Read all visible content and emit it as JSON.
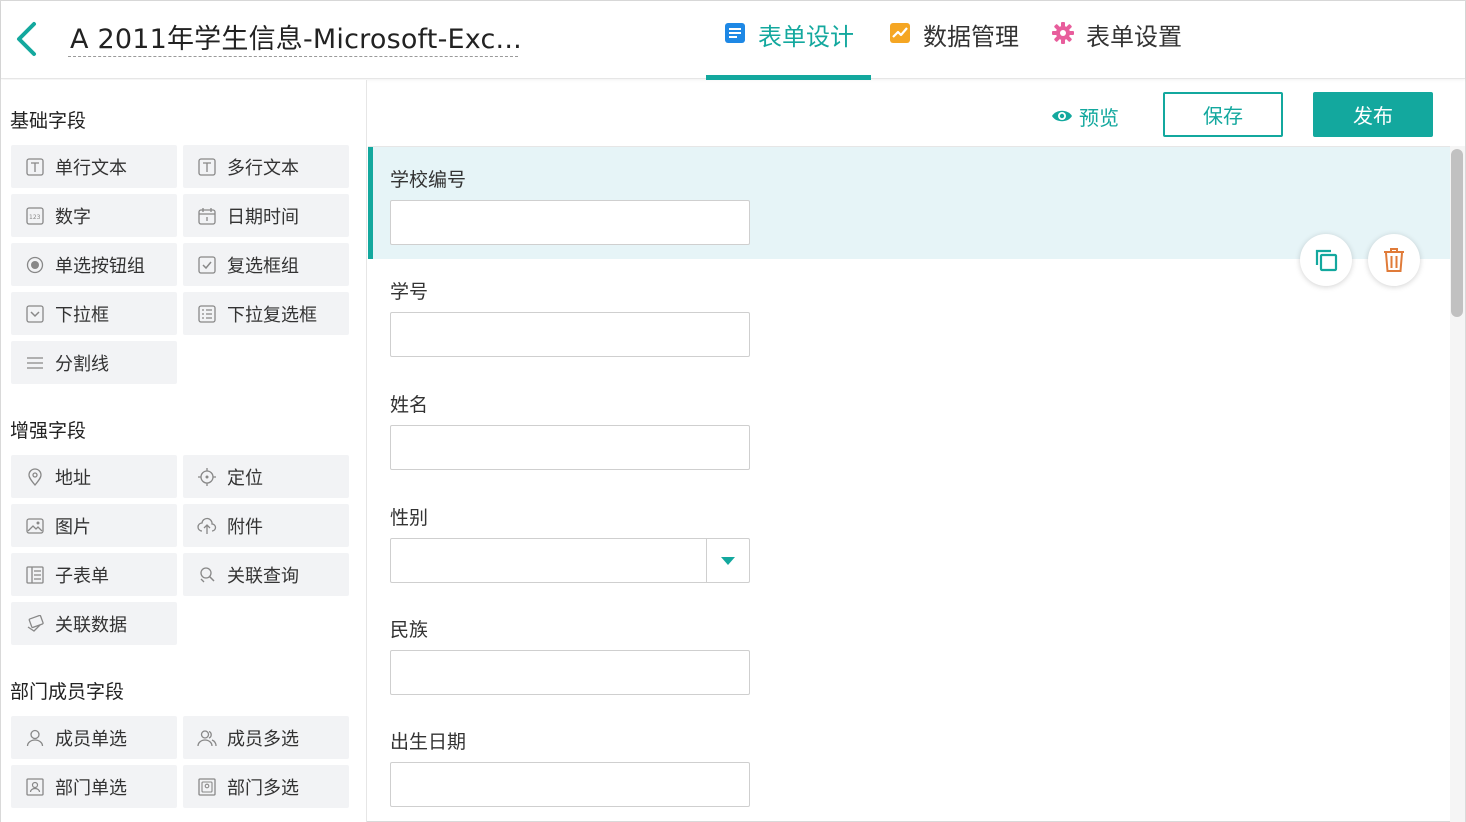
{
  "header": {
    "title": "A 2011年学生信息-Microsoft-Exc...",
    "tabs": [
      {
        "label": "表单设计",
        "icon": "form-doc-icon",
        "active": true
      },
      {
        "label": "数据管理",
        "icon": "chart-icon",
        "active": false
      },
      {
        "label": "表单设置",
        "icon": "gear-icon",
        "active": false
      }
    ]
  },
  "sidebar": {
    "sections": [
      {
        "title": "基础字段",
        "items": [
          {
            "label": "单行文本",
            "icon": "text-icon"
          },
          {
            "label": "多行文本",
            "icon": "textarea-icon"
          },
          {
            "label": "数字",
            "icon": "number-icon"
          },
          {
            "label": "日期时间",
            "icon": "calendar-icon"
          },
          {
            "label": "单选按钮组",
            "icon": "radio-icon"
          },
          {
            "label": "复选框组",
            "icon": "checkbox-icon"
          },
          {
            "label": "下拉框",
            "icon": "dropdown-icon"
          },
          {
            "label": "下拉复选框",
            "icon": "dropdown-checklist-icon"
          },
          {
            "label": "分割线",
            "icon": "divider-icon"
          }
        ]
      },
      {
        "title": "增强字段",
        "items": [
          {
            "label": "地址",
            "icon": "location-pin-icon"
          },
          {
            "label": "定位",
            "icon": "crosshair-icon"
          },
          {
            "label": "图片",
            "icon": "image-icon"
          },
          {
            "label": "附件",
            "icon": "cloud-upload-icon"
          },
          {
            "label": "子表单",
            "icon": "subform-icon"
          },
          {
            "label": "关联查询",
            "icon": "link-search-icon"
          },
          {
            "label": "关联数据",
            "icon": "link-data-icon"
          }
        ]
      },
      {
        "title": "部门成员字段",
        "items": [
          {
            "label": "成员单选",
            "icon": "user-icon"
          },
          {
            "label": "成员多选",
            "icon": "users-icon"
          },
          {
            "label": "部门单选",
            "icon": "department-icon"
          },
          {
            "label": "部门多选",
            "icon": "departments-icon"
          }
        ]
      }
    ]
  },
  "toolbar": {
    "preview_label": "预览",
    "save_label": "保存",
    "publish_label": "发布"
  },
  "form": {
    "fields": [
      {
        "label": "学校编号",
        "type": "text",
        "value": "",
        "selected": true
      },
      {
        "label": "学号",
        "type": "text",
        "value": ""
      },
      {
        "label": "姓名",
        "type": "text",
        "value": ""
      },
      {
        "label": "性别",
        "type": "select",
        "value": ""
      },
      {
        "label": "民族",
        "type": "text",
        "value": ""
      },
      {
        "label": "出生日期",
        "type": "text",
        "value": ""
      }
    ],
    "actions": {
      "copy_icon": "copy-icon",
      "delete_icon": "trash-icon"
    }
  },
  "colors": {
    "accent": "#13a89e",
    "selected_bg": "#e6f4f7",
    "chart_icon": "#f5a623",
    "gear_icon": "#e85d9c",
    "doc_icon": "#1e88e5",
    "trash_icon": "#e07b39"
  }
}
